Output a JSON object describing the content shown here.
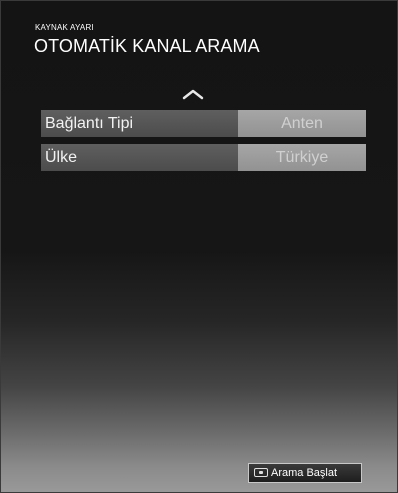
{
  "header": {
    "subtitle": "KAYNAK AYARI",
    "title": "OTOMATİK KANAL ARAMA"
  },
  "settings": [
    {
      "label": "Bağlantı Tipi",
      "value": "Anten"
    },
    {
      "label": "Ülke",
      "value": "Türkiye"
    }
  ],
  "footer": {
    "start_search_label": "Arama Başlat",
    "button_icon": "remote-key-icon"
  },
  "colors": {
    "text": "#ffffff",
    "row_label_bg": "#555555",
    "row_value_bg": "#9c9c9c",
    "row_value_text": "#d0d0d0"
  }
}
